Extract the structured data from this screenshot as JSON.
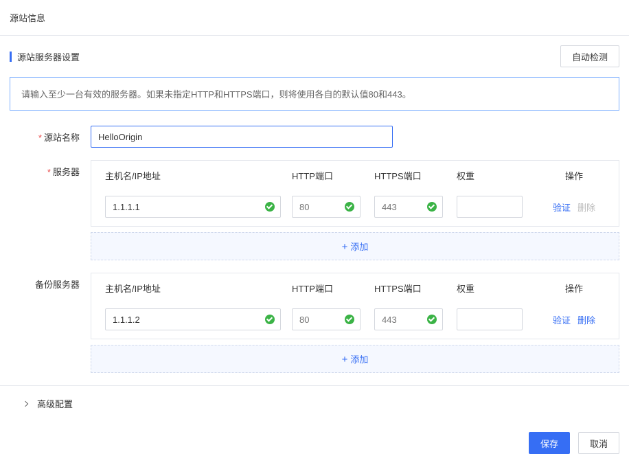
{
  "page_title": "源站信息",
  "section": {
    "title": "源站服务器设置",
    "auto_detect_label": "自动检测"
  },
  "info_text": "请输入至少一台有效的服务器。如果未指定HTTP和HTTPS端口，则将使用各自的默认值80和443。",
  "labels": {
    "origin_name": "源站名称",
    "server": "服务器",
    "backup_server": "备份服务器",
    "advanced": "高级配置"
  },
  "origin_name_value": "HelloOrigin",
  "columns": {
    "host": "主机名/IP地址",
    "http": "HTTP端口",
    "https": "HTTPS端口",
    "weight": "权重",
    "action": "操作"
  },
  "primary_servers": [
    {
      "host": "1.1.1.1",
      "http_placeholder": "80",
      "https_placeholder": "443",
      "weight": "",
      "delete_enabled": false
    }
  ],
  "backup_servers": [
    {
      "host": "1.1.1.2",
      "http_placeholder": "80",
      "https_placeholder": "443",
      "weight": "",
      "delete_enabled": true
    }
  ],
  "actions": {
    "verify": "验证",
    "delete": "删除",
    "add": "添加"
  },
  "footer": {
    "save": "保存",
    "cancel": "取消"
  }
}
